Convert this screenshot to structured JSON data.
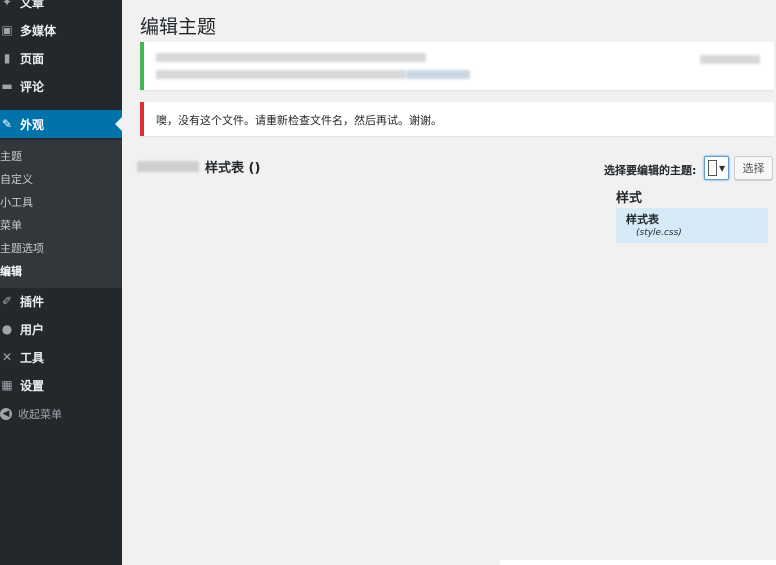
{
  "sidebar": {
    "items": [
      {
        "label": "文章",
        "icon": "pin-icon"
      },
      {
        "label": "多媒体",
        "icon": "media-icon"
      },
      {
        "label": "页面",
        "icon": "page-icon"
      },
      {
        "label": "评论",
        "icon": "comment-icon"
      },
      {
        "label": "外观",
        "icon": "brush-icon"
      },
      {
        "label": "插件",
        "icon": "plugin-icon"
      },
      {
        "label": "用户",
        "icon": "user-icon"
      },
      {
        "label": "工具",
        "icon": "wrench-icon"
      },
      {
        "label": "设置",
        "icon": "settings-icon"
      }
    ],
    "submenu": [
      "主题",
      "自定义",
      "小工具",
      "菜单",
      "主题选项",
      "编辑"
    ],
    "collapse_label": "收起菜单"
  },
  "main": {
    "title": "编辑主题",
    "error_notice": "噢，没有这个文件。请重新检查文件名，然后再试。谢谢。",
    "file_heading": "样式表 ()",
    "select_label": "选择要编辑的主题:",
    "select_button": "选择",
    "styles_heading": "样式",
    "file_name_label": "样式表",
    "file_name": "(style.css)"
  },
  "colors": {
    "sidebar_bg": "#23282d",
    "active_bg": "#0073aa",
    "success_border": "#46b450",
    "error_border": "#dc3232"
  }
}
